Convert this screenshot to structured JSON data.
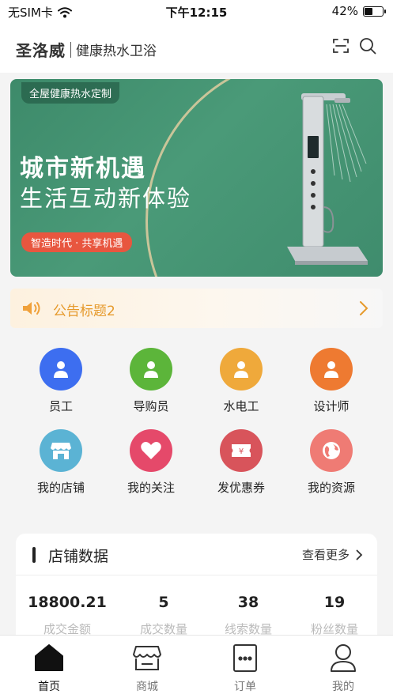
{
  "status_bar": {
    "carrier": "无SIM卡",
    "time": "下午12:15",
    "battery": "42%"
  },
  "header": {
    "brand": "圣洛威",
    "slogan": "健康热水卫浴",
    "icons": [
      "scan-icon",
      "search-icon"
    ]
  },
  "banner": {
    "tag": "全屋健康热水定制",
    "headline": "城市新机遇",
    "subheadline": "生活互动新体验",
    "pill": "智造时代 · 共享机遇"
  },
  "notice": {
    "text": "公告标题2"
  },
  "menu": [
    {
      "label": "员工",
      "color": "#3d6ef0",
      "icon": "person-icon"
    },
    {
      "label": "导购员",
      "color": "#5cb53a",
      "icon": "person-icon"
    },
    {
      "label": "水电工",
      "color": "#efa93b",
      "icon": "person-icon"
    },
    {
      "label": "设计师",
      "color": "#ee7a31",
      "icon": "person-icon"
    },
    {
      "label": "我的店铺",
      "color": "#5bb3d4",
      "icon": "store-icon"
    },
    {
      "label": "我的关注",
      "color": "#e5496a",
      "icon": "heart-icon"
    },
    {
      "label": "发优惠券",
      "color": "#d8545b",
      "icon": "coupon-icon"
    },
    {
      "label": "我的资源",
      "color": "#ef7b74",
      "icon": "globe-icon"
    }
  ],
  "store_data": {
    "title": "店铺数据",
    "more": "查看更多",
    "stats": [
      {
        "value": "18800.21",
        "label": "成交金额"
      },
      {
        "value": "5",
        "label": "成交数量"
      },
      {
        "value": "38",
        "label": "线索数量"
      },
      {
        "value": "19",
        "label": "粉丝数量"
      }
    ]
  },
  "tabbar": [
    {
      "label": "首页",
      "icon": "home-icon",
      "active": true
    },
    {
      "label": "商城",
      "icon": "shop-icon",
      "active": false
    },
    {
      "label": "订单",
      "icon": "order-icon",
      "active": false
    },
    {
      "label": "我的",
      "icon": "user-icon",
      "active": false
    }
  ]
}
